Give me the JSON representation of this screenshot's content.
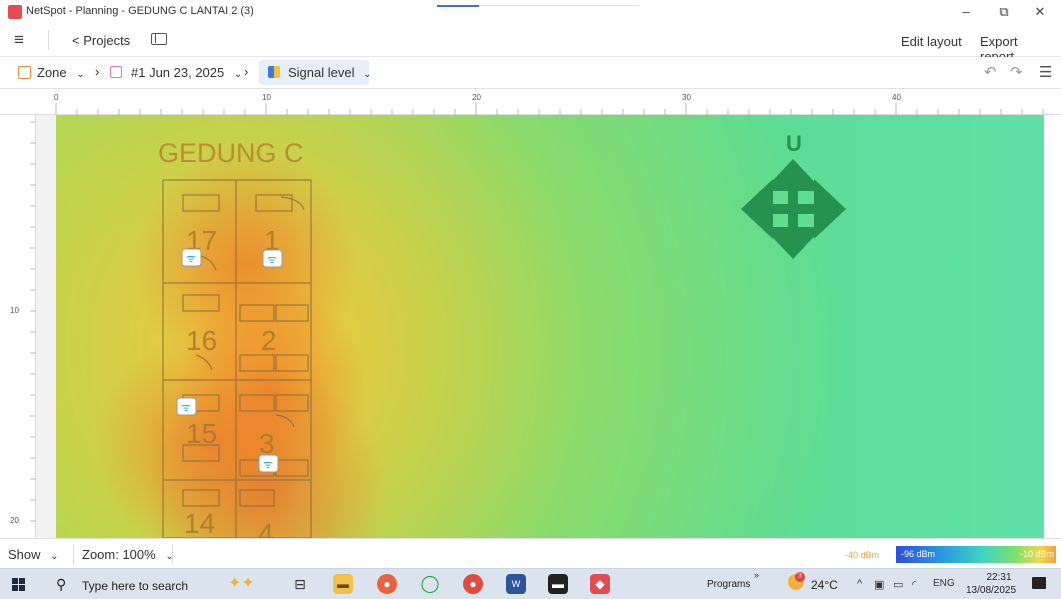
{
  "window": {
    "title": "NetSpot - Planning - GEDUNG C LANTAI 2 (3)",
    "minimize": "–",
    "restore": "⧉",
    "close": "✕"
  },
  "toolbar": {
    "projects_label": "Projects",
    "edit_layout_label": "Edit layout",
    "export_report_label": "Export report..."
  },
  "breadcrumb": {
    "zone_label": "Zone",
    "survey_label": "#1 Jun 23, 2025",
    "visualization_label": "Signal level"
  },
  "ruler": {
    "x_ticks": [
      "0",
      "10",
      "20",
      "30",
      "40"
    ],
    "y_ticks": [
      "10",
      "20"
    ]
  },
  "floorplan": {
    "building_label": "GEDUNG C",
    "compass_label": "U",
    "rooms": [
      "17",
      "1",
      "16",
      "2",
      "15",
      "3",
      "14",
      "4"
    ],
    "access_point_count": 4
  },
  "colors": {
    "accent": "#3b6fd8",
    "compass": "#1f8a4a",
    "plan_lines": "#8a6a3a",
    "ap_badge": "#20a8d8"
  },
  "legend": {
    "show_label": "Show",
    "zoom_label": "Zoom: 100%",
    "min_db_label": "-40 dBm",
    "low_db_label": "-96 dBm",
    "high_db_label": "-10 dBm"
  },
  "taskbar": {
    "search_placeholder": "Type here to search",
    "programs_label": "Programs",
    "weather_badge": "3",
    "temperature": "24°C",
    "language": "ENG",
    "time": "22:31",
    "date": "13/08/2025"
  }
}
